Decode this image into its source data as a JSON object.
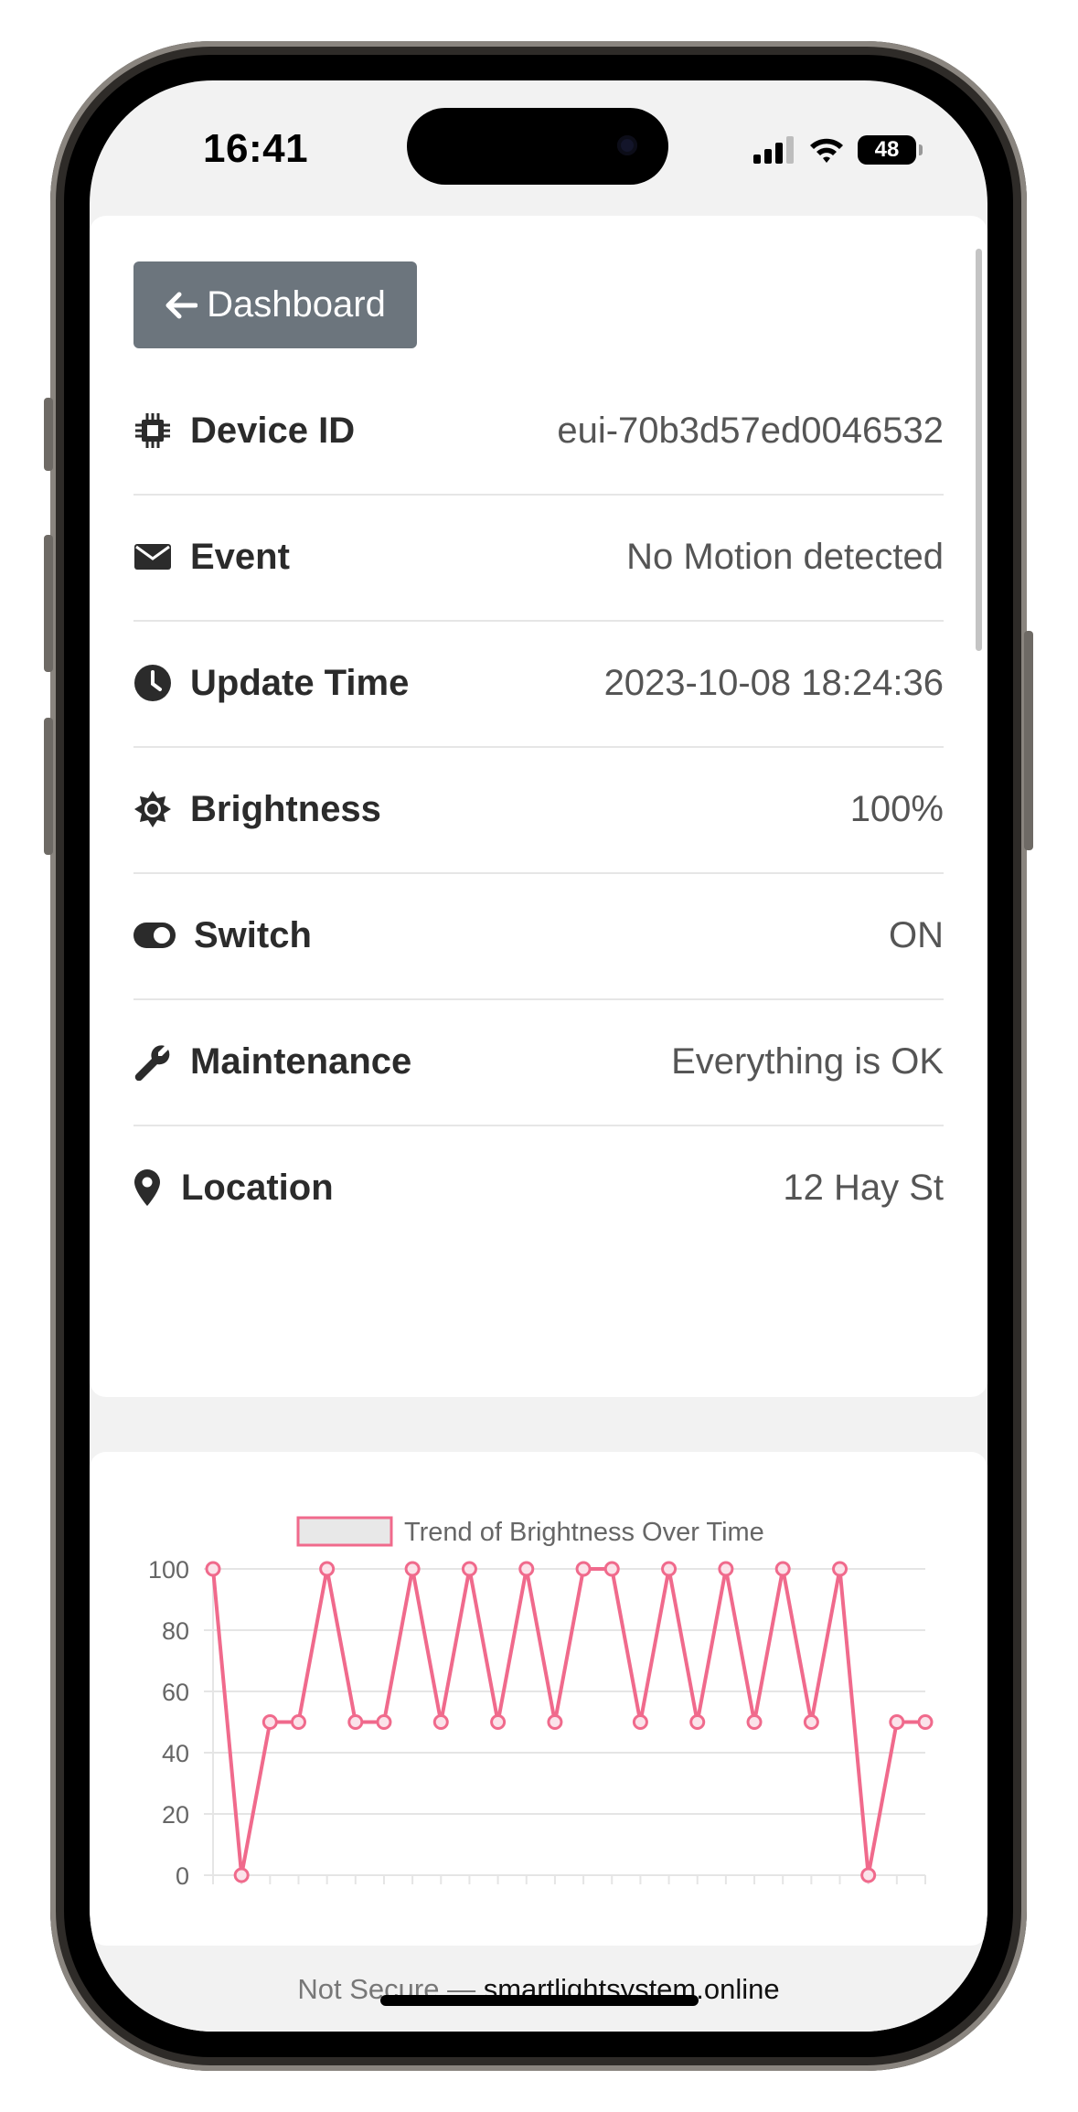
{
  "status": {
    "time": "16:41",
    "battery": "48"
  },
  "back_button": {
    "label": "Dashboard"
  },
  "details": [
    {
      "icon": "chip-icon",
      "label": "Device ID",
      "value": "eui-70b3d57ed0046532"
    },
    {
      "icon": "envelope-icon",
      "label": "Event",
      "value": "No Motion detected"
    },
    {
      "icon": "clock-icon",
      "label": "Update Time",
      "value": "2023-10-08 18:24:36"
    },
    {
      "icon": "brightness-icon",
      "label": "Brightness",
      "value": "100%"
    },
    {
      "icon": "toggle-icon",
      "label": "Switch",
      "value": "ON"
    },
    {
      "icon": "wrench-icon",
      "label": "Maintenance",
      "value": "Everything is OK"
    },
    {
      "icon": "map-pin-icon",
      "label": "Location",
      "value": "12 Hay St"
    }
  ],
  "colors": {
    "accent": "#f06a8c",
    "button": "#6c757d"
  },
  "chart_data": {
    "type": "line",
    "legend": "Trend of Brightness Over Time",
    "x": [
      1,
      2,
      3,
      4,
      5,
      6,
      7,
      8,
      9,
      10,
      11,
      12,
      13,
      14,
      15,
      16,
      17,
      18,
      19,
      20,
      21,
      22,
      23,
      24,
      25,
      26
    ],
    "values": [
      100,
      0,
      50,
      50,
      100,
      50,
      50,
      100,
      50,
      100,
      50,
      100,
      50,
      100,
      100,
      50,
      100,
      50,
      100,
      50,
      100,
      50,
      100,
      0,
      50,
      50
    ],
    "yticks": [
      "100",
      "80",
      "60",
      "40",
      "20",
      "0"
    ],
    "ylim": [
      0,
      100
    ],
    "grid": true,
    "legend_position": "top"
  },
  "url_bar": {
    "prefix": "Not Secure —",
    "domain": "smartlightsystem.online"
  }
}
